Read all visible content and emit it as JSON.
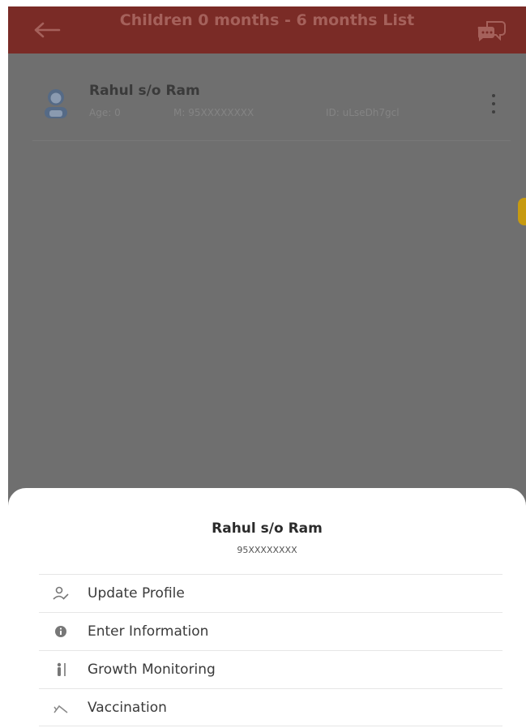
{
  "appbar": {
    "title": "Children 0 months - 6 months List",
    "back_icon": "arrow-left-icon",
    "chat_icon": "chat-bubbles-icon",
    "colors": {
      "background": "#7a2b26",
      "title": "#a5615b"
    }
  },
  "list": {
    "items": [
      {
        "name": "Rahul s/o Ram",
        "age": "Age: 0",
        "mobile": "M: 95XXXXXXXX",
        "id": "ID: uLseDh7gcl",
        "avatar_icon": "child-avatar-icon",
        "menu_icon": "kebab-menu-icon"
      }
    ]
  },
  "overlay_color": "#6f6f6f",
  "accent_color": "#c79a10",
  "sheet": {
    "name": "Rahul s/o Ram",
    "mobile": "95XXXXXXXX",
    "menu": [
      {
        "label": "Update Profile",
        "icon": "user-edit-icon"
      },
      {
        "label": "Enter Information",
        "icon": "info-icon"
      },
      {
        "label": "Growth Monitoring",
        "icon": "height-measure-icon"
      },
      {
        "label": "Vaccination",
        "icon": "syringe-icon"
      }
    ]
  }
}
